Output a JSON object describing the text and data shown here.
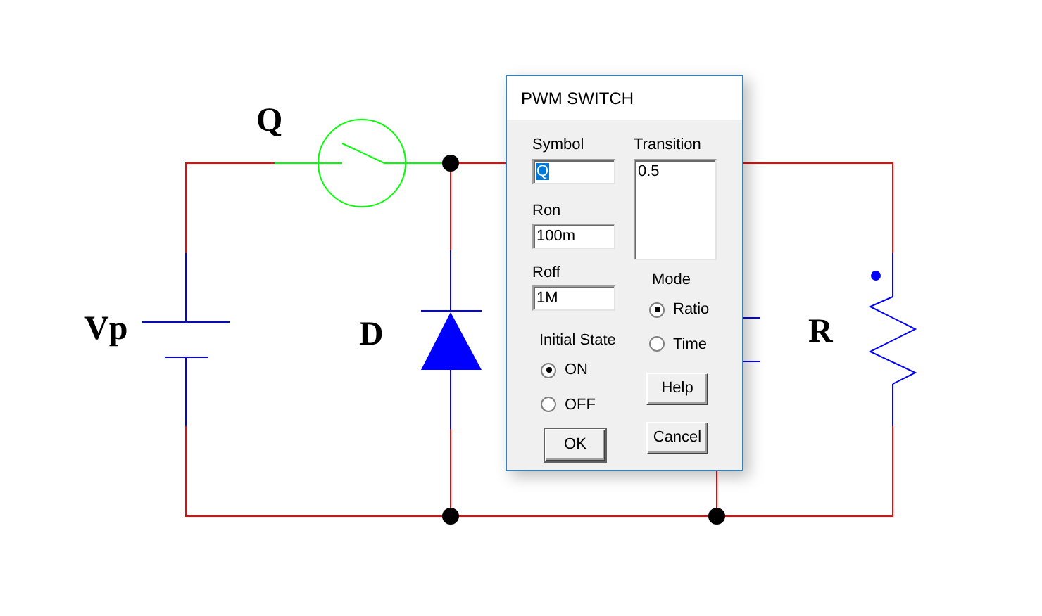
{
  "circuit": {
    "labels": [
      {
        "kind": "switch",
        "text": "Q"
      },
      {
        "kind": "source",
        "text": "Vp"
      },
      {
        "kind": "diode",
        "text": "D"
      },
      {
        "kind": "resistor",
        "text": "R"
      }
    ]
  },
  "dialog": {
    "title": "PWM SWITCH",
    "symbol": {
      "label": "Symbol",
      "value": "Q",
      "highlighted": true
    },
    "ron": {
      "label": "Ron",
      "value": "100m"
    },
    "roff": {
      "label": "Roff",
      "value": "1M"
    },
    "transition": {
      "label": "Transition",
      "value": "0.5"
    },
    "initial_state": {
      "label": "Initial State",
      "options": [
        {
          "label": "ON",
          "selected": true
        },
        {
          "label": "OFF",
          "selected": false
        }
      ]
    },
    "mode": {
      "label": "Mode",
      "options": [
        {
          "label": "Ratio",
          "selected": true
        },
        {
          "label": "Time",
          "selected": false
        }
      ]
    },
    "buttons": [
      {
        "label": "OK",
        "default": true
      },
      {
        "label": "Help",
        "default": false
      },
      {
        "label": "Cancel",
        "default": false
      }
    ]
  }
}
